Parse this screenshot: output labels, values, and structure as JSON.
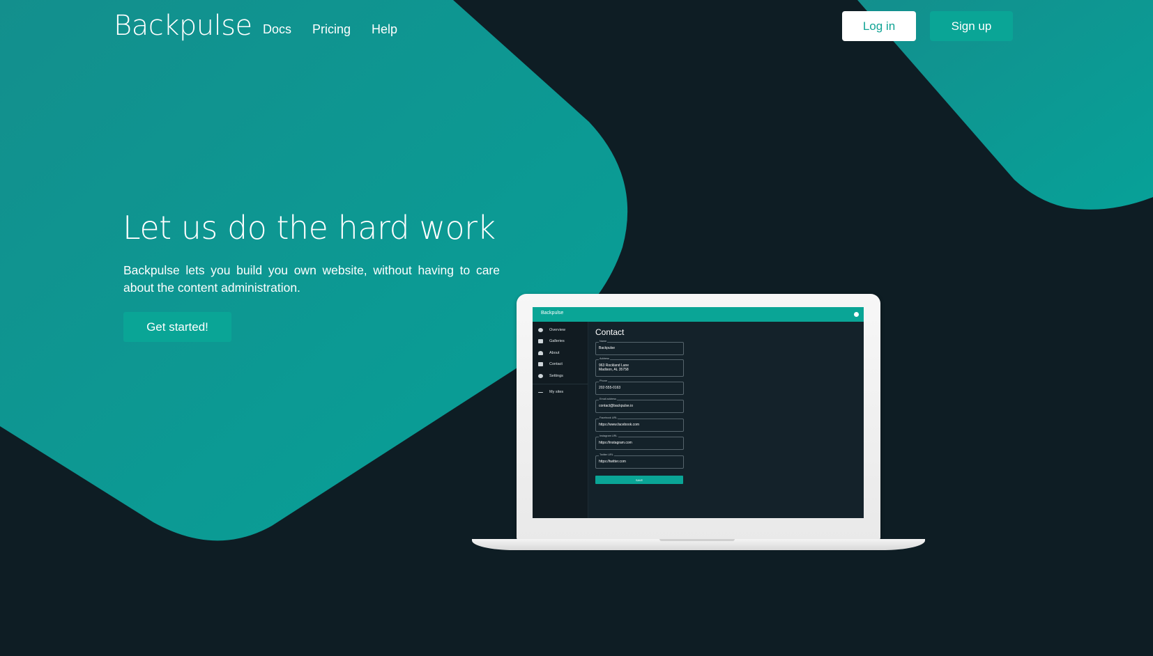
{
  "header": {
    "logo": "Backpulse",
    "nav": [
      "Docs",
      "Pricing",
      "Help"
    ],
    "login_label": "Log in",
    "signup_label": "Sign up"
  },
  "hero": {
    "title": "Let us do the hard work",
    "description": "Backpulse lets you build you own website, without having to care about the content administration.",
    "cta_label": "Get started!"
  },
  "mockup": {
    "app_title": "Backpulse",
    "sidebar": [
      "Overview",
      "Galleries",
      "About",
      "Contact",
      "Settings"
    ],
    "sidebar_back": "My sites",
    "page_title": "Contact",
    "fields": [
      {
        "label": "Name",
        "value": "Backpulse"
      },
      {
        "label": "Address",
        "value": "963 Rockland Lane\nMadison, AL 35758"
      },
      {
        "label": "Phone",
        "value": "202-555-0163"
      },
      {
        "label": "Email address",
        "value": "contact@backpulse.io"
      },
      {
        "label": "Facebook URL",
        "value": "https://www.facebook.com"
      },
      {
        "label": "Instagram URL",
        "value": "https://instagram.com"
      },
      {
        "label": "Twitter URL",
        "value": "https://twitter.com"
      }
    ],
    "save_label": "SAVE"
  },
  "colors": {
    "background": "#0e1d24",
    "accent": "#0aa596",
    "shape": "#0b9994"
  }
}
